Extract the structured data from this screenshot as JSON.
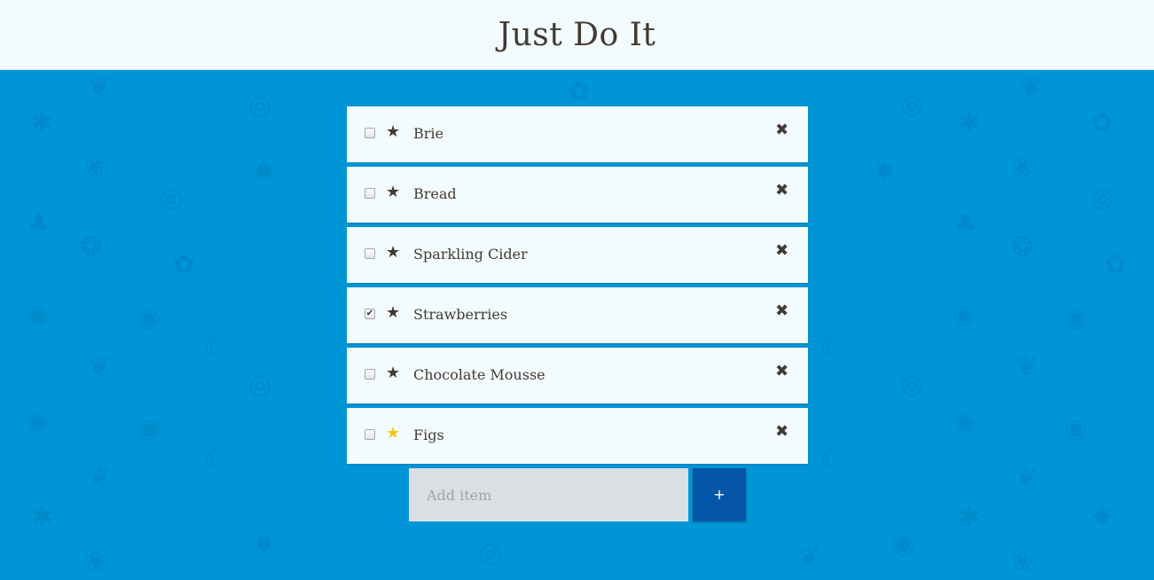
{
  "header": {
    "title": "Just Do It"
  },
  "items": [
    {
      "label": "Brie",
      "checked": false,
      "starred": false,
      "star_icon": "★",
      "delete_icon": "✖"
    },
    {
      "label": "Bread",
      "checked": false,
      "starred": false,
      "star_icon": "★",
      "delete_icon": "✖"
    },
    {
      "label": "Sparkling Cider",
      "checked": false,
      "starred": false,
      "star_icon": "★",
      "delete_icon": "✖"
    },
    {
      "label": "Strawberries",
      "checked": true,
      "starred": false,
      "star_icon": "★",
      "delete_icon": "✖"
    },
    {
      "label": "Chocolate Mousse",
      "checked": false,
      "starred": false,
      "star_icon": "★",
      "delete_icon": "✖"
    },
    {
      "label": "Figs",
      "checked": false,
      "starred": true,
      "star_icon": "★",
      "delete_icon": "✖"
    }
  ],
  "add": {
    "placeholder": "Add item",
    "value": "",
    "button_label": "+"
  },
  "colors": {
    "background": "#0095d6",
    "panel": "#f2fbfd",
    "text": "#433a33",
    "star_active": "#f5c618",
    "add_button": "#0456a8",
    "input_bg": "#d9dfe2"
  },
  "background_icons": [
    "food-pattern-icon"
  ]
}
